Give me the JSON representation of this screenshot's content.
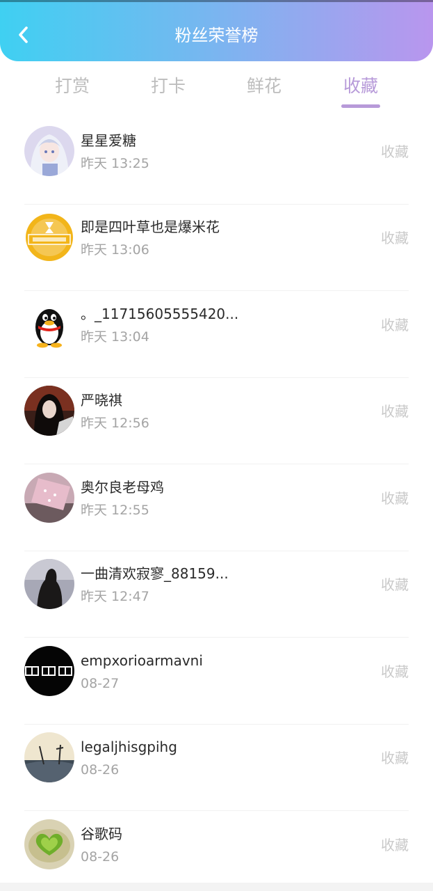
{
  "header": {
    "title": "粉丝荣誉榜",
    "back_icon": "chevron-left-icon"
  },
  "tabs": [
    {
      "label": "打赏",
      "active": false
    },
    {
      "label": "打卡",
      "active": false
    },
    {
      "label": "鲜花",
      "active": false
    },
    {
      "label": "收藏",
      "active": true
    }
  ],
  "colors": {
    "header_gradient": [
      "#3fd0f2",
      "#74b8f0",
      "#b996ee"
    ],
    "active_tab": "#b79ad9",
    "inactive_tab": "#bdbdbd"
  },
  "rows": [
    {
      "name": "星星爱糖",
      "time": "昨天 13:25",
      "action": "收藏",
      "avatar": "anime-girl-avatar"
    },
    {
      "name": "即是四叶草也是爆米花",
      "time": "昨天 13:06",
      "action": "收藏",
      "avatar": "tfboys-logo-avatar"
    },
    {
      "name": "。_11715605555420...",
      "time": "昨天 13:04",
      "action": "收藏",
      "avatar": "qq-penguin-avatar"
    },
    {
      "name": "严晓祺",
      "time": "昨天 12:56",
      "action": "收藏",
      "avatar": "dark-portrait-avatar"
    },
    {
      "name": "奥尔良老母鸡",
      "time": "昨天 12:55",
      "action": "收藏",
      "avatar": "pink-photo-avatar"
    },
    {
      "name": "一曲清欢寂寥_88159...",
      "time": "昨天 12:47",
      "action": "收藏",
      "avatar": "silhouette-avatar"
    },
    {
      "name": "empxorioarmavni",
      "time": "08-27",
      "action": "收藏",
      "avatar": "text-logo-avatar"
    },
    {
      "name": "legaljhisgpihg",
      "time": "08-26",
      "action": "收藏",
      "avatar": "landscape-avatar"
    },
    {
      "name": "谷歌码",
      "time": "08-26",
      "action": "收藏",
      "avatar": "green-heart-avatar"
    }
  ]
}
